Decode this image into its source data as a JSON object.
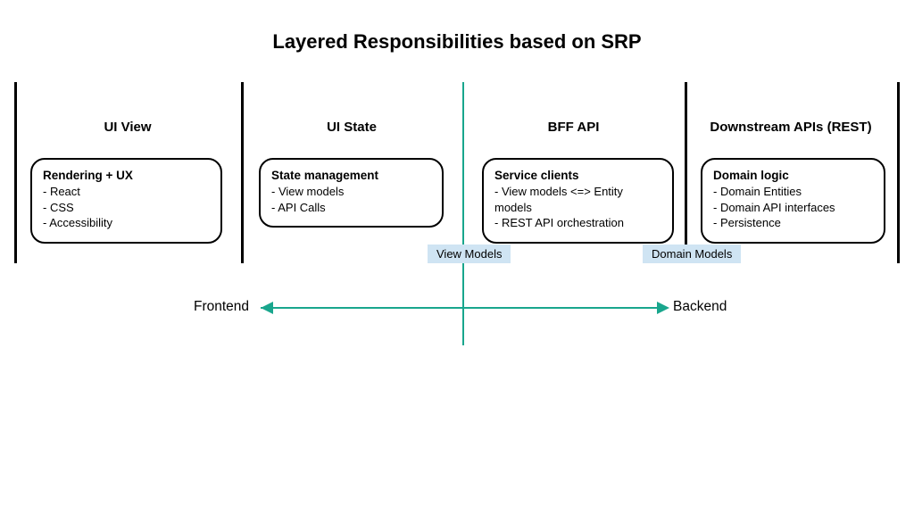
{
  "title": "Layered Responsibilities based on SRP",
  "columns": [
    {
      "title": "UI View",
      "box_heading": "Rendering + UX",
      "items": [
        "- React",
        "- CSS",
        "- Accessibility"
      ]
    },
    {
      "title": "UI State",
      "box_heading": "State management",
      "items": [
        "- View models",
        "- API Calls"
      ]
    },
    {
      "title": "BFF API",
      "box_heading": "Service clients",
      "items": [
        "- View models <=> Entity models",
        "- REST API orchestration"
      ]
    },
    {
      "title": "Downstream APIs (REST)",
      "box_heading": "Domain logic",
      "items": [
        "- Domain Entities",
        "- Domain API interfaces",
        "- Persistence"
      ]
    }
  ],
  "tags": {
    "view": "View Models",
    "domain": "Domain Models"
  },
  "arrow": {
    "left": "Frontend",
    "right": "Backend"
  },
  "colors": {
    "accent": "#19a68d",
    "tag_bg": "#cfe4f3"
  }
}
